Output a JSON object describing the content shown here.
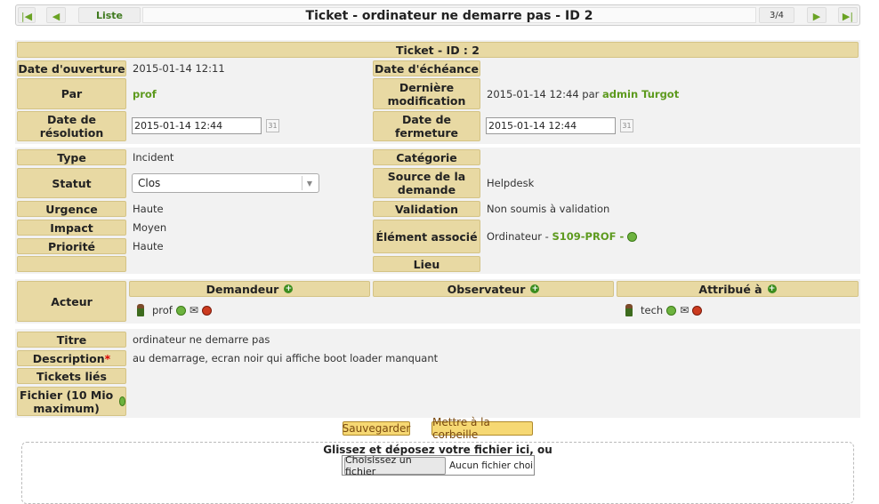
{
  "nav": {
    "first_icon": "first-arrow-icon",
    "prev_icon": "prev-arrow-icon",
    "list_label": "Liste",
    "title": "Ticket - ordinateur ne demarre pas - ID 2",
    "counter": "3/4",
    "next_icon": "next-arrow-icon",
    "last_icon": "last-arrow-icon"
  },
  "ticket_header": "Ticket - ID : 2",
  "dates": {
    "opening_label": "Date d'ouverture",
    "opening_value": "2015-01-14 12:11",
    "due_label": "Date d'échéance",
    "by_label": "Par",
    "by_value": "prof",
    "lastmod_label": "Dernière modification",
    "lastmod_value": "2015-01-14 12:44 par",
    "lastmod_user": "admin Turgot",
    "resolution_label": "Date de résolution",
    "resolution_value": "2015-01-14 12:44",
    "closing_label": "Date de fermeture",
    "closing_value": "2015-01-14 12:44",
    "calendar_text": "31"
  },
  "details": {
    "type_label": "Type",
    "type_value": "Incident",
    "category_label": "Catégorie",
    "status_label": "Statut",
    "status_value": "Clos",
    "source_label": "Source de la demande",
    "source_value": "Helpdesk",
    "urgency_label": "Urgence",
    "urgency_value": "Haute",
    "validation_label": "Validation",
    "validation_value": "Non soumis à validation",
    "impact_label": "Impact",
    "impact_value": "Moyen",
    "associated_label": "Élément associé",
    "associated_prefix": "Ordinateur -",
    "associated_item": "S109-PROF -",
    "priority_label": "Priorité",
    "priority_value": "Haute",
    "location_label": "Lieu"
  },
  "actors": {
    "label": "Acteur",
    "requester_label": "Demandeur",
    "observer_label": "Observateur",
    "assigned_label": "Attribué à",
    "requester_name": "prof",
    "assigned_name": "tech"
  },
  "content": {
    "title_label": "Titre",
    "title_value": "ordinateur ne demarre pas",
    "description_label": "Description",
    "required_mark": "*",
    "description_value": "au demarrage, ecran noir qui affiche boot loader manquant",
    "linked_label": "Tickets liés",
    "file_label": "Fichier (10 Mio maximum)"
  },
  "actions": {
    "save_label": "Sauvegarder",
    "trash_label": "Mettre à la corbeille"
  },
  "upload": {
    "dropzone_text": "Glissez et déposez votre fichier ici, ou",
    "choose_label": "Choisissez un fichier",
    "no_file_text": "Aucun fichier choisi"
  }
}
